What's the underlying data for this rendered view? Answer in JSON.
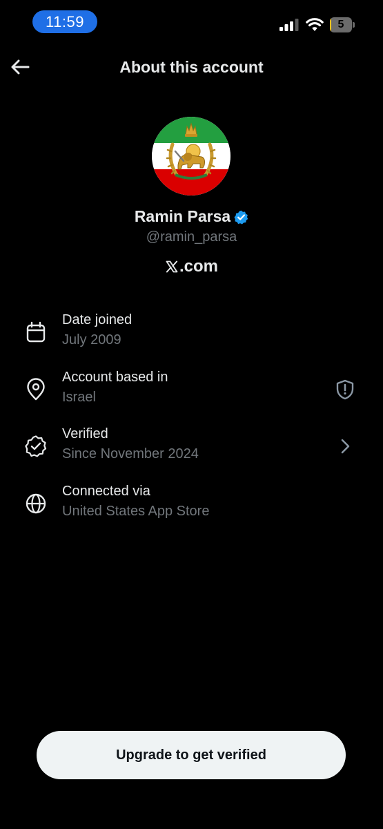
{
  "status_bar": {
    "time": "11:59",
    "battery_level": "5",
    "battery_fraction": 0.05,
    "time_pill_color": "#1f6fe6",
    "battery_color": "#f2c21b"
  },
  "header": {
    "title": "About this account",
    "back_icon": "arrow-left-icon"
  },
  "profile": {
    "display_name": "Ramin Parsa",
    "handle": "@ramin_parsa",
    "verified_badge_color": "#1d9bf0",
    "site": ".com",
    "site_icon": "x-logo-icon",
    "avatar": "lion-and-sun-emblem"
  },
  "info_rows": [
    {
      "icon": "calendar-icon",
      "title": "Date joined",
      "value": "July 2009"
    },
    {
      "icon": "location-pin-icon",
      "title": "Account based in",
      "value": "Israel",
      "trailing_icon": "shield-icon"
    },
    {
      "icon": "verified-check-icon",
      "title": "Verified",
      "value": "Since November 2024",
      "trailing_icon": "chevron-right-icon"
    },
    {
      "icon": "globe-icon",
      "title": "Connected via",
      "value": "United States App Store"
    }
  ],
  "footer": {
    "button_label": "Upgrade to get verified"
  },
  "colors": {
    "background": "#000000",
    "primary_text": "#e7e9ea",
    "secondary_text": "#71767b",
    "button_bg": "#eff3f4"
  }
}
